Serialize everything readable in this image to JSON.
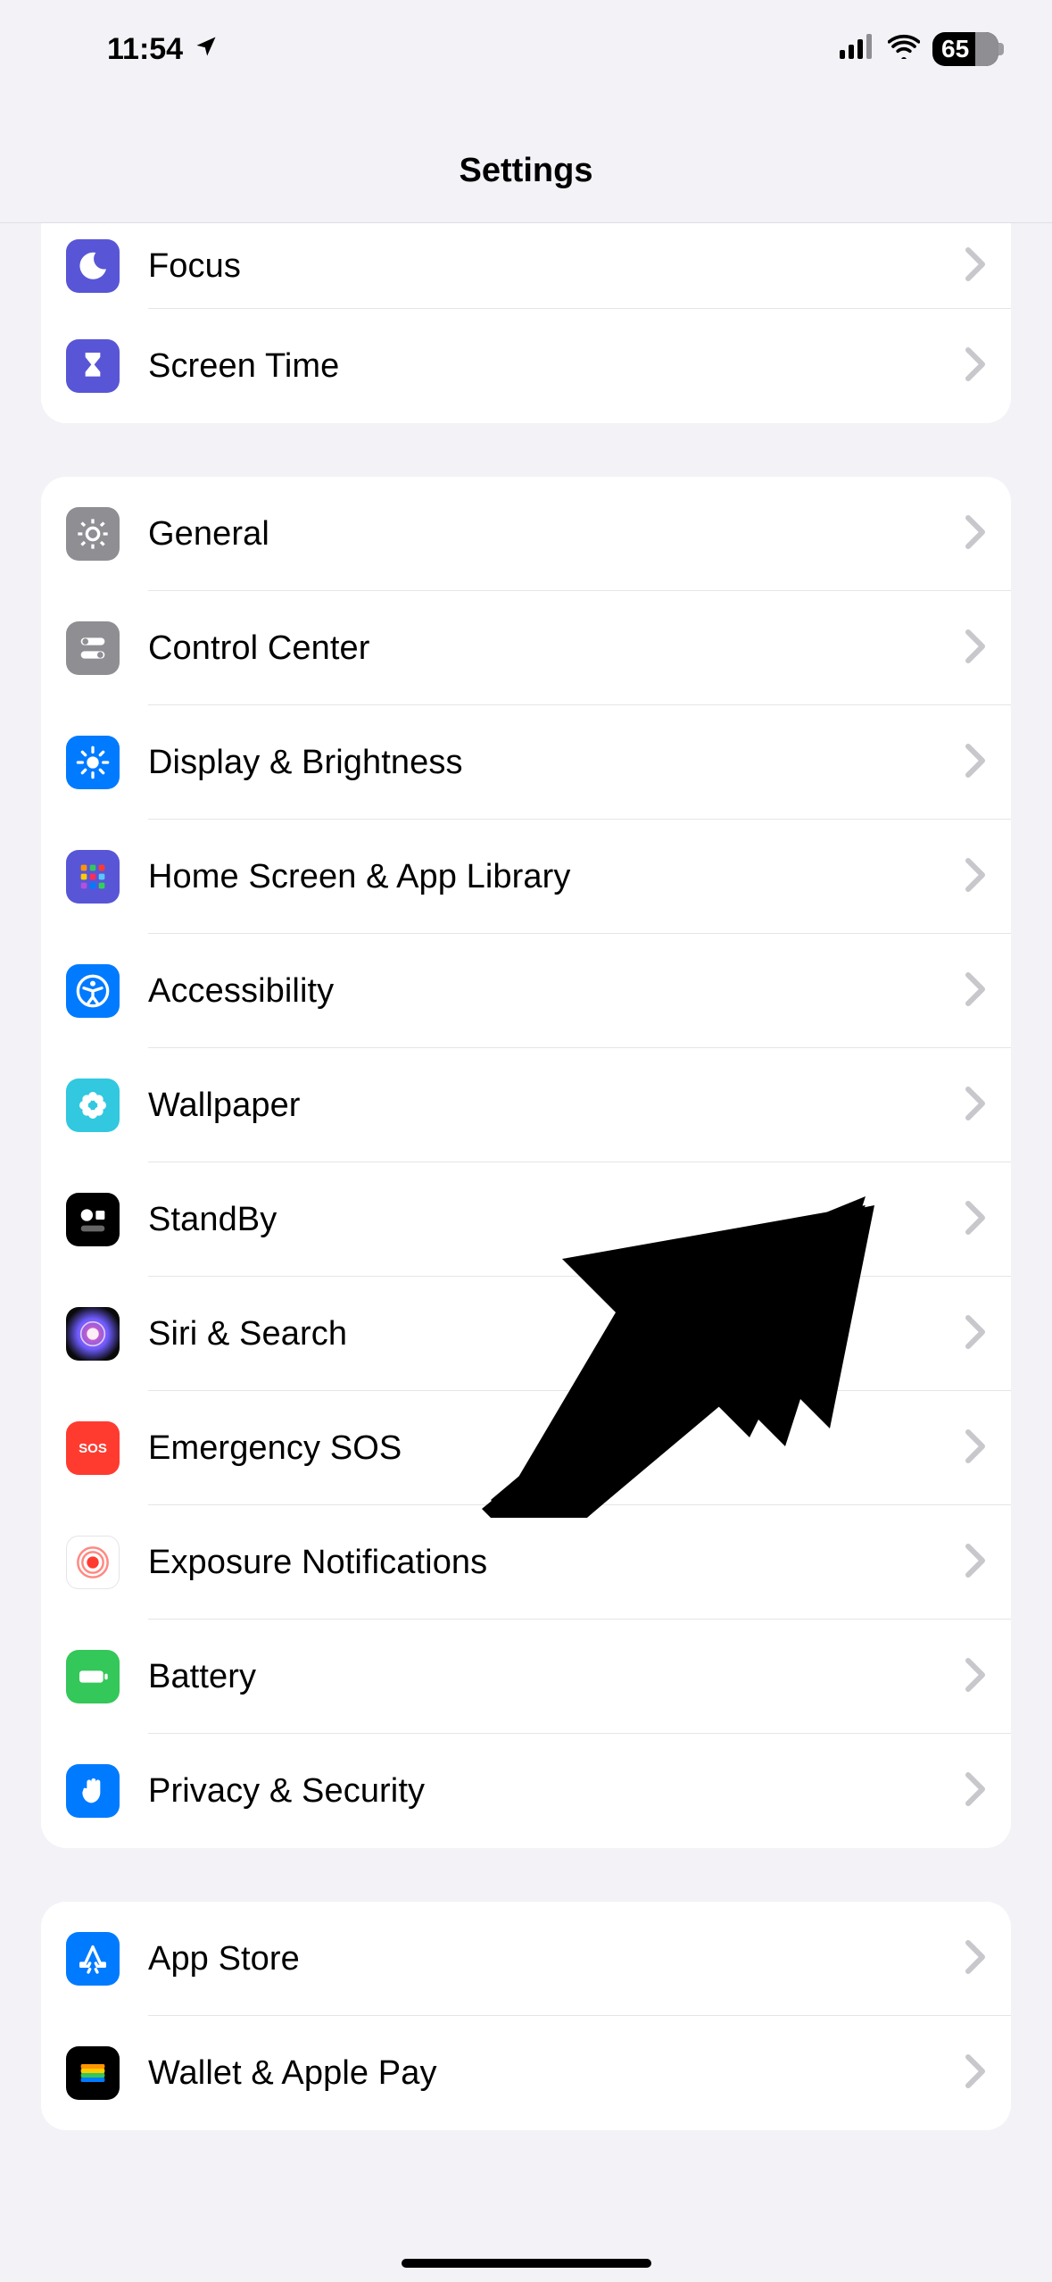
{
  "status": {
    "time": "11:54",
    "battery": "65"
  },
  "title": "Settings",
  "groups": [
    {
      "id": "group-focus",
      "rows": [
        {
          "id": "focus",
          "label": "Focus",
          "icon": "moon",
          "bg": "#5856d6"
        },
        {
          "id": "screen-time",
          "label": "Screen Time",
          "icon": "hourglass",
          "bg": "#5856d6"
        }
      ]
    },
    {
      "id": "group-general",
      "rows": [
        {
          "id": "general",
          "label": "General",
          "icon": "gear",
          "bg": "#8e8e93"
        },
        {
          "id": "control-ctr",
          "label": "Control Center",
          "icon": "toggles",
          "bg": "#8e8e93"
        },
        {
          "id": "display",
          "label": "Display & Brightness",
          "icon": "sun",
          "bg": "#007aff"
        },
        {
          "id": "home-screen",
          "label": "Home Screen & App Library",
          "icon": "grid",
          "bg": "#5856d6"
        },
        {
          "id": "accessibility",
          "label": "Accessibility",
          "icon": "a11y",
          "bg": "#007aff"
        },
        {
          "id": "wallpaper",
          "label": "Wallpaper",
          "icon": "flower",
          "bg": "#31c8e0"
        },
        {
          "id": "standby",
          "label": "StandBy",
          "icon": "standby",
          "bg": "#000000"
        },
        {
          "id": "siri",
          "label": "Siri & Search",
          "icon": "siri",
          "bg": "#1c1c1e"
        },
        {
          "id": "sos",
          "label": "Emergency SOS",
          "icon": "sos",
          "bg": "#ff3b30"
        },
        {
          "id": "exposure",
          "label": "Exposure Notifications",
          "icon": "exposure",
          "bg": "#ffffff"
        },
        {
          "id": "battery",
          "label": "Battery",
          "icon": "battery",
          "bg": "#34c759"
        },
        {
          "id": "privacy",
          "label": "Privacy & Security",
          "icon": "hand",
          "bg": "#007aff"
        }
      ]
    },
    {
      "id": "group-store",
      "rows": [
        {
          "id": "app-store",
          "label": "App Store",
          "icon": "appstore",
          "bg": "#007aff"
        },
        {
          "id": "wallet",
          "label": "Wallet & Apple Pay",
          "icon": "wallet",
          "bg": "#000000"
        }
      ]
    }
  ],
  "annotation": {
    "type": "arrow",
    "target_row_id": "sos",
    "target_label": "Emergency SOS"
  }
}
